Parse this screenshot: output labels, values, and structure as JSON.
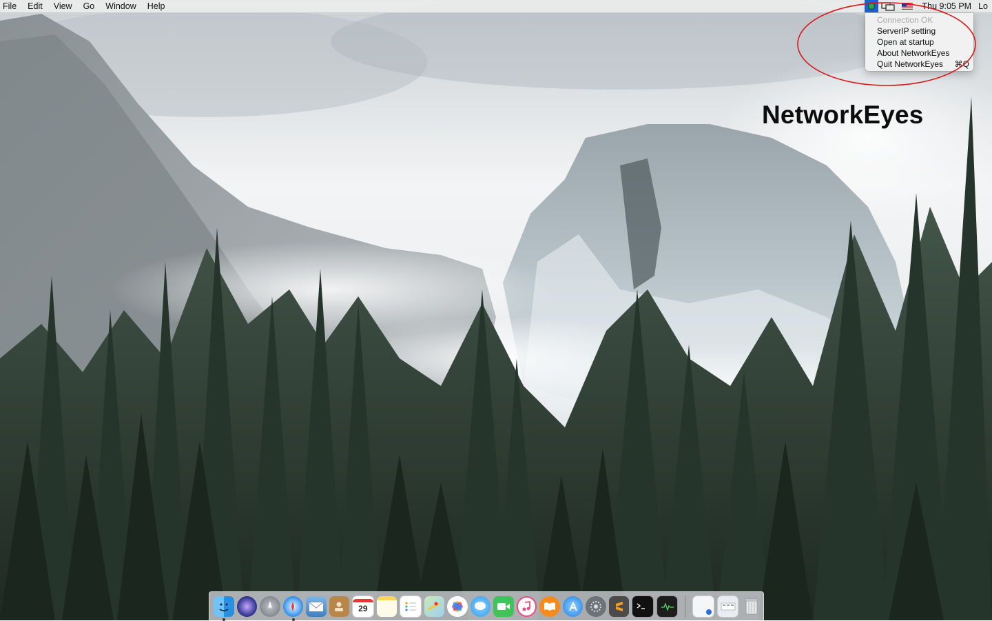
{
  "menubar": {
    "items": [
      "File",
      "Edit",
      "View",
      "Go",
      "Window",
      "Help"
    ],
    "status_icons": [
      "networkeyes-status-icon",
      "display-mirror-icon",
      "us-flag-input-icon"
    ],
    "clock": "Thu 9:05 PM",
    "user": "Lo"
  },
  "dropdown": {
    "items": [
      {
        "label": "Connection OK",
        "enabled": false
      },
      {
        "label": "ServerIP setting",
        "enabled": true
      },
      {
        "label": "Open at startup",
        "enabled": true
      },
      {
        "label": "About NetworkEyes",
        "enabled": true
      },
      {
        "label": "Quit NetworkEyes",
        "enabled": true,
        "shortcut": "⌘Q"
      }
    ]
  },
  "overlay": {
    "title": "NetworkEyes"
  },
  "annotation": {
    "color": "#d81616"
  },
  "dock": {
    "calendar_day": "29",
    "apps": [
      "finder-icon",
      "siri-icon",
      "launchpad-icon",
      "safari-icon",
      "mail-icon",
      "contacts-icon",
      "calendar-icon",
      "notes-icon",
      "reminders-icon",
      "maps-icon",
      "photos-icon",
      "messages-icon",
      "facetime-icon",
      "itunes-icon",
      "ibooks-icon",
      "app-store-icon",
      "system-preferences-icon",
      "sublime-text-icon",
      "terminal-icon",
      "activity-monitor-icon"
    ],
    "right": [
      "downloads-stack-icon",
      "documents-stack-icon",
      "trash-icon"
    ]
  },
  "colors": {
    "menubar_bg": "#ececec",
    "selected_status": "#1f5fd6",
    "status_ok": "#2fa84a"
  }
}
